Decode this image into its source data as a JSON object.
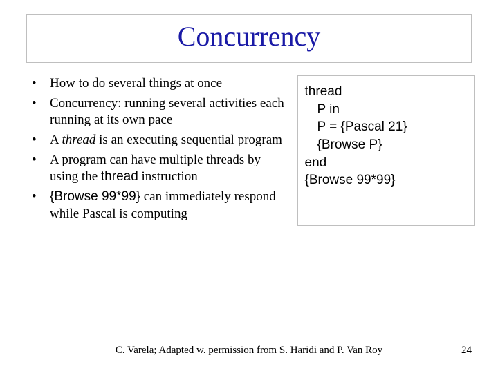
{
  "title": "Concurrency",
  "bullets": {
    "b1": "How to do several things at once",
    "b2_pre": "Concurrency: running several activities each running at its own pace",
    "b3_a": "A ",
    "b3_thread": "thread",
    "b3_b": " is an executing sequential program",
    "b4_a": "A program can have multiple threads by using the ",
    "b4_kw": "thread",
    "b4_b": " instruction",
    "b5_code": "{Browse 99*99}",
    "b5_rest": " can immediately respond while Pascal is computing"
  },
  "code": {
    "l1_kw": "thread",
    "l2_a": "P ",
    "l2_kw": "in",
    "l3": "P = {Pascal 21}",
    "l4": "{Browse P}",
    "l5_kw": "end",
    "l6": "{Browse 99*99}"
  },
  "footer": {
    "credit": "C. Varela;  Adapted w. permission from S. Haridi and P. Van Roy",
    "page": "24"
  }
}
